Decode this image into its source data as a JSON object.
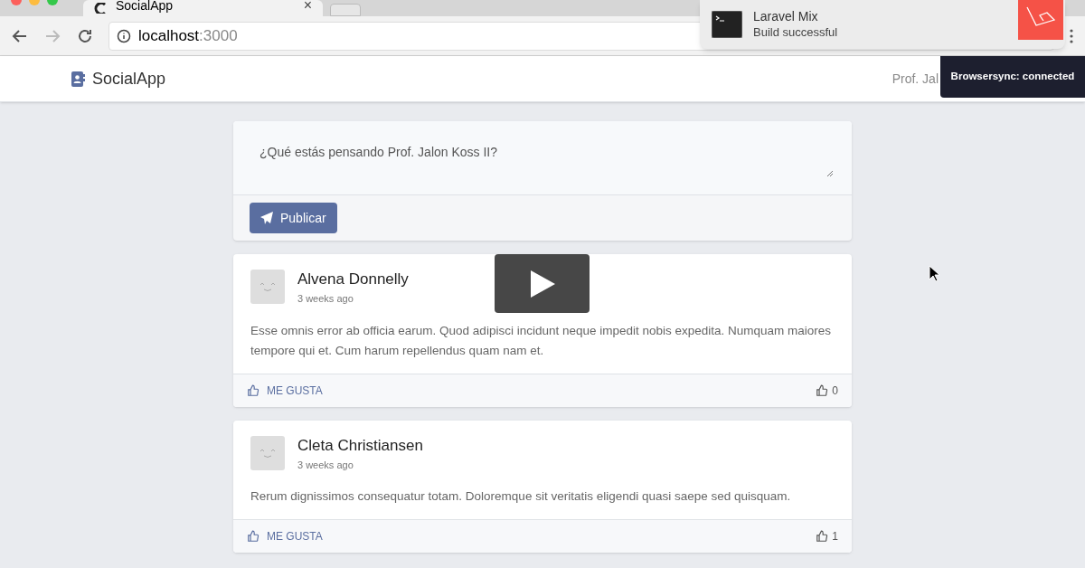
{
  "browser": {
    "tab": {
      "title": "SocialApp",
      "close": "×"
    },
    "address": {
      "host": "localhost",
      "port": ":3000"
    }
  },
  "notification": {
    "title": "Laravel Mix",
    "message": "Build successful"
  },
  "toast": {
    "text": "Browsersync: connected"
  },
  "navbar": {
    "brand": "SocialApp",
    "user": "Prof. Jal"
  },
  "composer": {
    "placeholder": "¿Qué estás pensando Prof. Jalon Koss II?",
    "button": "Publicar"
  },
  "posts": [
    {
      "author": "Alvena Donnelly",
      "time": "3 weeks ago",
      "body": "Esse omnis error ab officia earum. Quod adipisci incidunt neque impedit nobis expedita. Numquam maiores tempore qui et. Cum harum repellendus quam nam et.",
      "like_label": "ME GUSTA",
      "likes": "0"
    },
    {
      "author": "Cleta Christiansen",
      "time": "3 weeks ago",
      "body": "Rerum dignissimos consequatur totam. Doloremque sit veritatis eligendi quasi saepe sed quisquam.",
      "like_label": "ME GUSTA",
      "likes": "1"
    }
  ]
}
